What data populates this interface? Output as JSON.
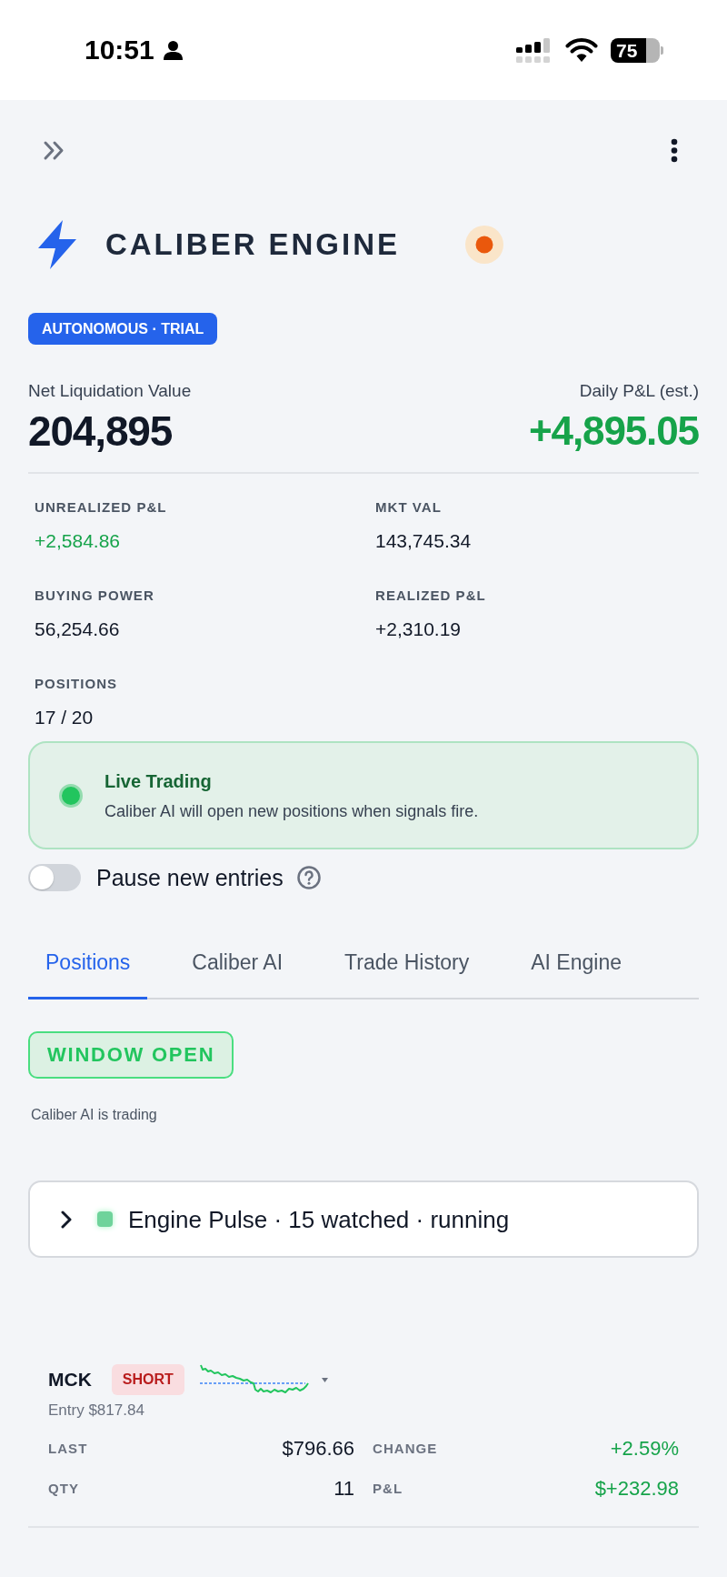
{
  "status_bar": {
    "time": "10:51",
    "battery": "75"
  },
  "header": {
    "title": "CALIBER ENGINE",
    "badge": "AUTONOMOUS · TRIAL"
  },
  "summary": {
    "net_liquidation": {
      "label": "Net Liquidation Value",
      "value": "204,895"
    },
    "daily_pnl": {
      "label": "Daily P&L (est.)",
      "value": "+4,895.05"
    }
  },
  "stats": [
    {
      "label": "UNREALIZED P&L",
      "value": "+2,584.86",
      "kind": "gain"
    },
    {
      "label": "MKT VAL",
      "value": "143,745.34",
      "kind": "plain"
    },
    {
      "label": "BUYING POWER",
      "value": "56,254.66",
      "kind": "plain"
    },
    {
      "label": "REALIZED P&L",
      "value": "+2,310.19",
      "kind": "plain"
    },
    {
      "label": "POSITIONS",
      "value": "17 / 20",
      "kind": "plain"
    }
  ],
  "live_status": {
    "title": "Live Trading",
    "text": "Caliber AI will open new positions when signals fire."
  },
  "pause_toggle": {
    "label": "Pause new entries",
    "on": false
  },
  "tabs": [
    {
      "label": "Positions",
      "selected": true
    },
    {
      "label": "Caliber AI",
      "selected": false
    },
    {
      "label": "Trade History",
      "selected": false
    },
    {
      "label": "AI Engine",
      "selected": false
    }
  ],
  "window_badge": "WINDOW OPEN",
  "trading_note": "Caliber AI is trading",
  "engine_pulse": {
    "text": "Engine Pulse · 15 watched · running",
    "expanded": false
  },
  "positions": [
    {
      "symbol": "MCK",
      "side": "SHORT",
      "entry": "Entry $817.84",
      "fields": [
        {
          "label": "LAST",
          "value": "$796.66",
          "kind": "plain"
        },
        {
          "label": "CHANGE",
          "value": "+2.59%",
          "kind": "gain"
        },
        {
          "label": "QTY",
          "value": "11",
          "kind": "plain"
        },
        {
          "label": "P&L",
          "value": "$+232.98",
          "kind": "gain"
        }
      ]
    }
  ]
}
